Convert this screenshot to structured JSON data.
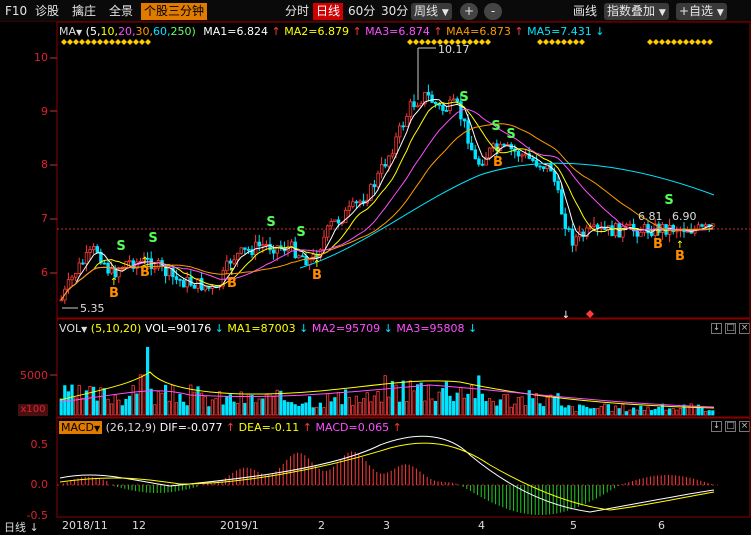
{
  "toolbar": {
    "items": [
      "F10",
      "诊股",
      "擒庄",
      "全景",
      "个股三分钟"
    ],
    "periods": [
      "分时",
      "日线",
      "60分",
      "30分"
    ],
    "week": "周线",
    "plus": "+",
    "minus": "-",
    "draw": "画线",
    "overlay": "指数叠加",
    "custom": "+自选"
  },
  "main": {
    "indicator_name": "MA",
    "params_open": "(5,",
    "params": [
      "10,",
      "20,",
      "30,",
      "60,",
      "250)"
    ],
    "ma": [
      "MA1=6.824",
      "MA2=6.879",
      "MA3=6.874",
      "MA4=6.873",
      "MA5=7.431"
    ],
    "y_ticks": [
      "10",
      "9",
      "8",
      "7",
      "6"
    ],
    "high_label": "10.17",
    "low_label": "5.35",
    "price_marks": [
      "6.81",
      "6.90"
    ],
    "buy_label": "B",
    "sell_label": "S"
  },
  "volume": {
    "indicator_name": "VOL",
    "params": "(5,10,20)",
    "values": [
      "VOL=90176",
      "MA1=87003",
      "MA2=95709",
      "MA3=95808"
    ],
    "y_tick": "5000",
    "unit": "x100"
  },
  "macd": {
    "indicator_name": "MACD",
    "params": "(26,12,9)",
    "values": [
      "DIF=-0.077",
      "DEA=-0.11",
      "MACD=0.065"
    ],
    "y_ticks": [
      "0.5",
      "0.0",
      "-0.5"
    ]
  },
  "dates": {
    "mode": "日线",
    "labels": [
      "2018/11",
      "12",
      "2019/1",
      "2",
      "3",
      "4",
      "5",
      "6"
    ]
  },
  "colors": {
    "up": "#ff3a3a",
    "down": "#00e5ff",
    "ma1": "#ffffff",
    "ma2": "#ffff00",
    "ma3": "#ff4fff",
    "ma4": "#ff9900",
    "ma5": "#00e5ff",
    "buy": "#ff8c00",
    "sell": "#55ff55"
  }
}
